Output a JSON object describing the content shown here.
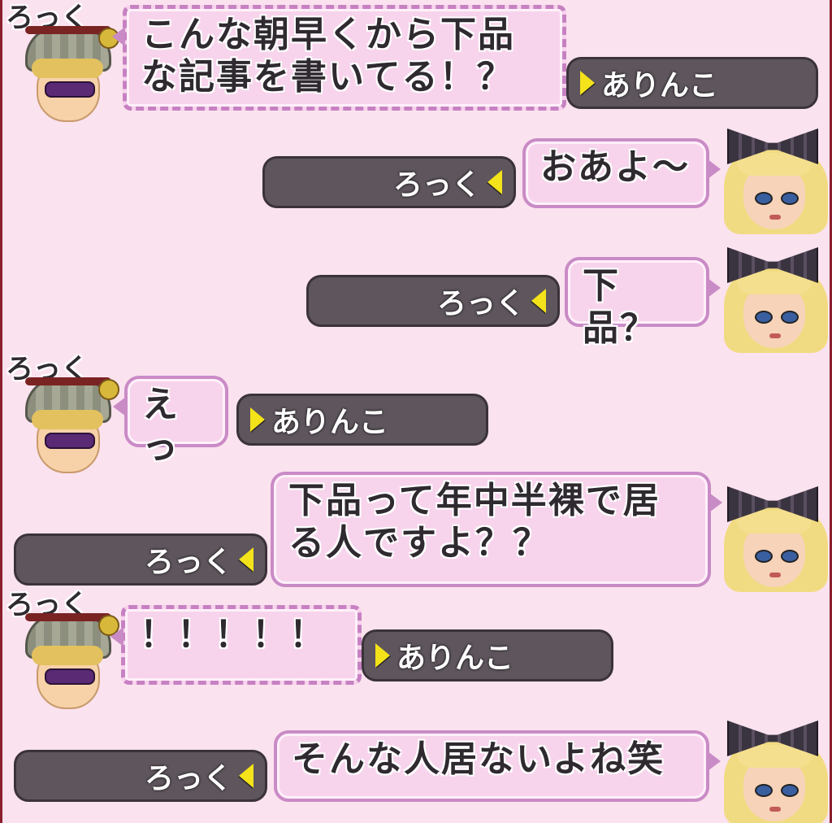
{
  "speakers": {
    "rokku": "ろっく",
    "arinko": "ありんこ"
  },
  "messages": [
    {
      "speaker": "rokku",
      "text": "こんな朝早くから下品\nな記事を書いてる！？",
      "bar_name": "ありんこ"
    },
    {
      "speaker": "arinko",
      "text": "おあよ〜",
      "bar_name": "ろっく"
    },
    {
      "speaker": "arinko",
      "text": "下品？",
      "bar_name": "ろっく"
    },
    {
      "speaker": "rokku",
      "text": "えっ",
      "bar_name": "ありんこ"
    },
    {
      "speaker": "arinko",
      "text": "下品って年中半裸で居\nる人ですよ？？",
      "bar_name": "ろっく"
    },
    {
      "speaker": "rokku",
      "text": "！！！！！",
      "bar_name": "ありんこ"
    },
    {
      "speaker": "arinko",
      "text": "そんな人居ないよね笑",
      "bar_name": "ろっく"
    }
  ],
  "icons": {
    "left_arrow": "yellow-triangle-left-icon",
    "right_arrow": "yellow-triangle-right-icon"
  },
  "colors": {
    "background": "#fbe2ef",
    "bubble_fill": "#f7d4ec",
    "bubble_border": "#c98bc6",
    "namebar": "#5e555d",
    "arrow": "#f4e21a"
  }
}
